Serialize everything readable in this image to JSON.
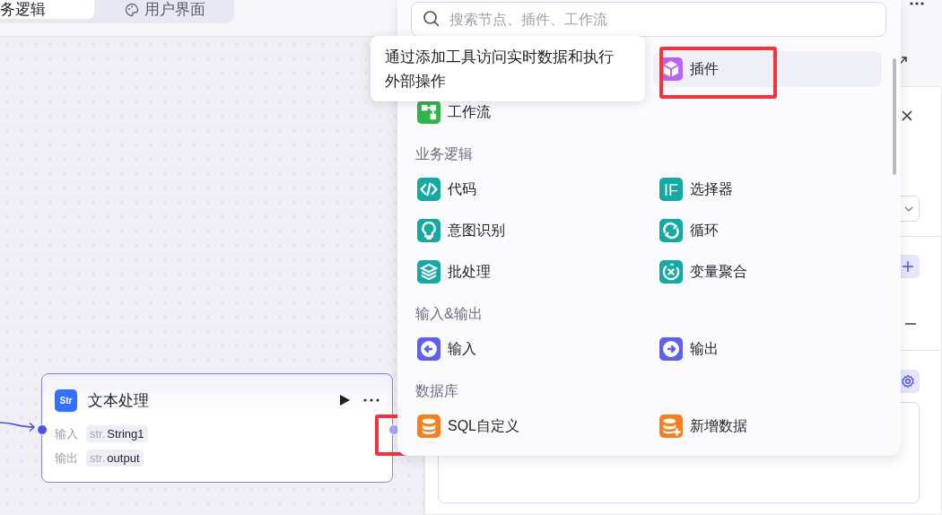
{
  "top_tabs": [
    {
      "label": "务逻辑",
      "selected": true
    },
    {
      "label": "用户界面",
      "selected": false
    }
  ],
  "node": {
    "icon_text": "Str",
    "title": "文本处理",
    "output_port_highlighted": true,
    "params": [
      {
        "label": "输入",
        "type": "str.",
        "name": "String1"
      },
      {
        "label": "输出",
        "type": "str.",
        "name": "output"
      }
    ]
  },
  "picker": {
    "search": {
      "placeholder": "搜索节点、插件、工作流"
    },
    "tooltip": "通过添加工具访问实时数据和执行外部操作",
    "sections": [
      {
        "items": [
          {
            "label": "插件",
            "color": "#b863f5",
            "hovered": true,
            "highlighted": true
          },
          {
            "label": "工作流",
            "color": "#2fb54a",
            "hovered": false,
            "highlighted": false
          }
        ]
      },
      {
        "title": "业务逻辑",
        "items": [
          {
            "label": "代码",
            "color": "#12aaa3",
            "hovered": false,
            "highlighted": false
          },
          {
            "label": "选择器",
            "color": "#12aaa3",
            "icon_text": "IF",
            "hovered": false,
            "highlighted": false
          },
          {
            "label": "意图识别",
            "color": "#12aaa3",
            "hovered": false,
            "highlighted": false
          },
          {
            "label": "循环",
            "color": "#12aaa3",
            "hovered": false,
            "highlighted": false
          },
          {
            "label": "批处理",
            "color": "#12aaa3",
            "hovered": false,
            "highlighted": false
          },
          {
            "label": "变量聚合",
            "color": "#12aaa3",
            "hovered": false,
            "highlighted": false
          }
        ]
      },
      {
        "title": "输入&输出",
        "items": [
          {
            "label": "输入",
            "color": "#5d5ff5",
            "hovered": false,
            "highlighted": false
          },
          {
            "label": "输出",
            "color": "#5d5ff5",
            "hovered": false,
            "highlighted": false
          }
        ]
      },
      {
        "title": "数据库",
        "items": [
          {
            "label": "SQL自定义",
            "color": "#f5801f",
            "hovered": false,
            "highlighted": false
          },
          {
            "label": "新增数据",
            "color": "#f5801f",
            "hovered": false,
            "highlighted": false
          }
        ]
      }
    ]
  }
}
